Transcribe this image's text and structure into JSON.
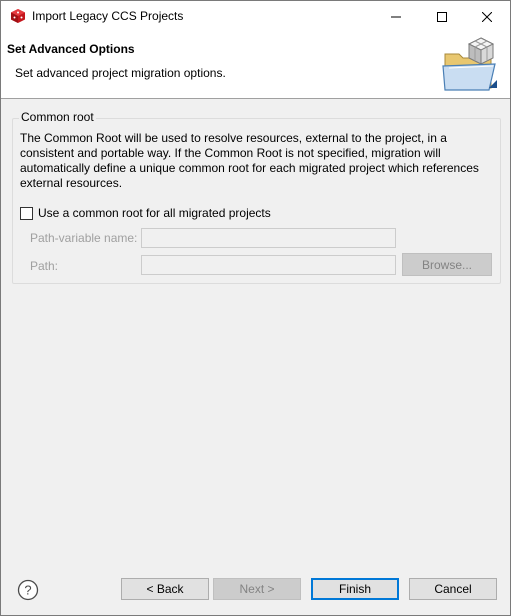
{
  "window": {
    "title": "Import Legacy CCS Projects",
    "controls": {
      "minimize": "minimize",
      "maximize": "maximize",
      "close": "close"
    }
  },
  "header": {
    "title": "Set Advanced Options",
    "description": "Set advanced project migration options."
  },
  "common_root": {
    "legend": "Common root",
    "description": "The Common Root will be used to resolve resources, external to the project, in a consistent and portable way. If the Common Root is not specified, migration will automatically define a unique common root for each migrated project which references external resources.",
    "checkbox_label": "Use a common root for all migrated projects",
    "checkbox_checked": false,
    "path_variable_label": "Path-variable name:",
    "path_variable_value": "",
    "path_label": "Path:",
    "path_value": "",
    "browse_label": "Browse..."
  },
  "footer": {
    "back_label": "< Back",
    "next_label": "Next >",
    "finish_label": "Finish",
    "cancel_label": "Cancel"
  },
  "colors": {
    "accent": "#0078d7",
    "disabled_text": "#838383",
    "app_icon": "#c4161c"
  }
}
